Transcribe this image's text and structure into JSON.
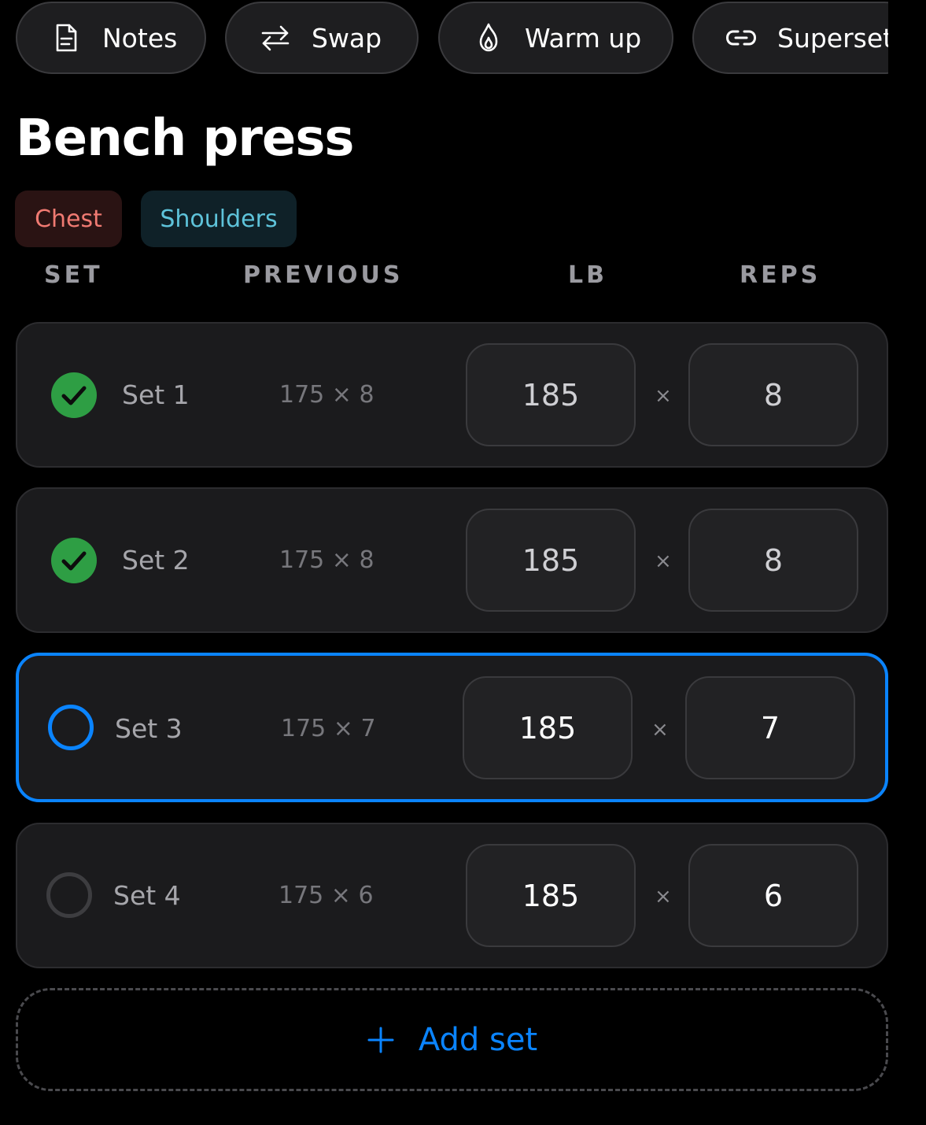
{
  "actions": [
    {
      "label": "Notes",
      "icon": "document-icon"
    },
    {
      "label": "Swap",
      "icon": "swap-arrows-icon"
    },
    {
      "label": "Warm up",
      "icon": "flame-icon"
    },
    {
      "label": "Superset",
      "icon": "link-icon"
    }
  ],
  "exercise": {
    "title": "Bench press",
    "tags": [
      "Chest",
      "Shoulders"
    ]
  },
  "columns": {
    "set": "SET",
    "previous": "PREVIOUS",
    "weight": "LB",
    "reps": "REPS"
  },
  "times_symbol": "×",
  "sets": [
    {
      "label": "Set 1",
      "previous": "175 × 8",
      "weight": "185",
      "reps": "8",
      "status": "completed"
    },
    {
      "label": "Set 2",
      "previous": "175 × 8",
      "weight": "185",
      "reps": "8",
      "status": "completed"
    },
    {
      "label": "Set 3",
      "previous": "175 × 7",
      "weight": "185",
      "reps": "7",
      "status": "current"
    },
    {
      "label": "Set 4",
      "previous": "175 × 6",
      "weight": "185",
      "reps": "6",
      "status": "pending"
    }
  ],
  "add_set_label": "Add set",
  "colors": {
    "accent": "#0a84ff",
    "completed": "#2e9e44",
    "chest_tag": "#f07a72",
    "shoulders_tag": "#5ec3da"
  }
}
